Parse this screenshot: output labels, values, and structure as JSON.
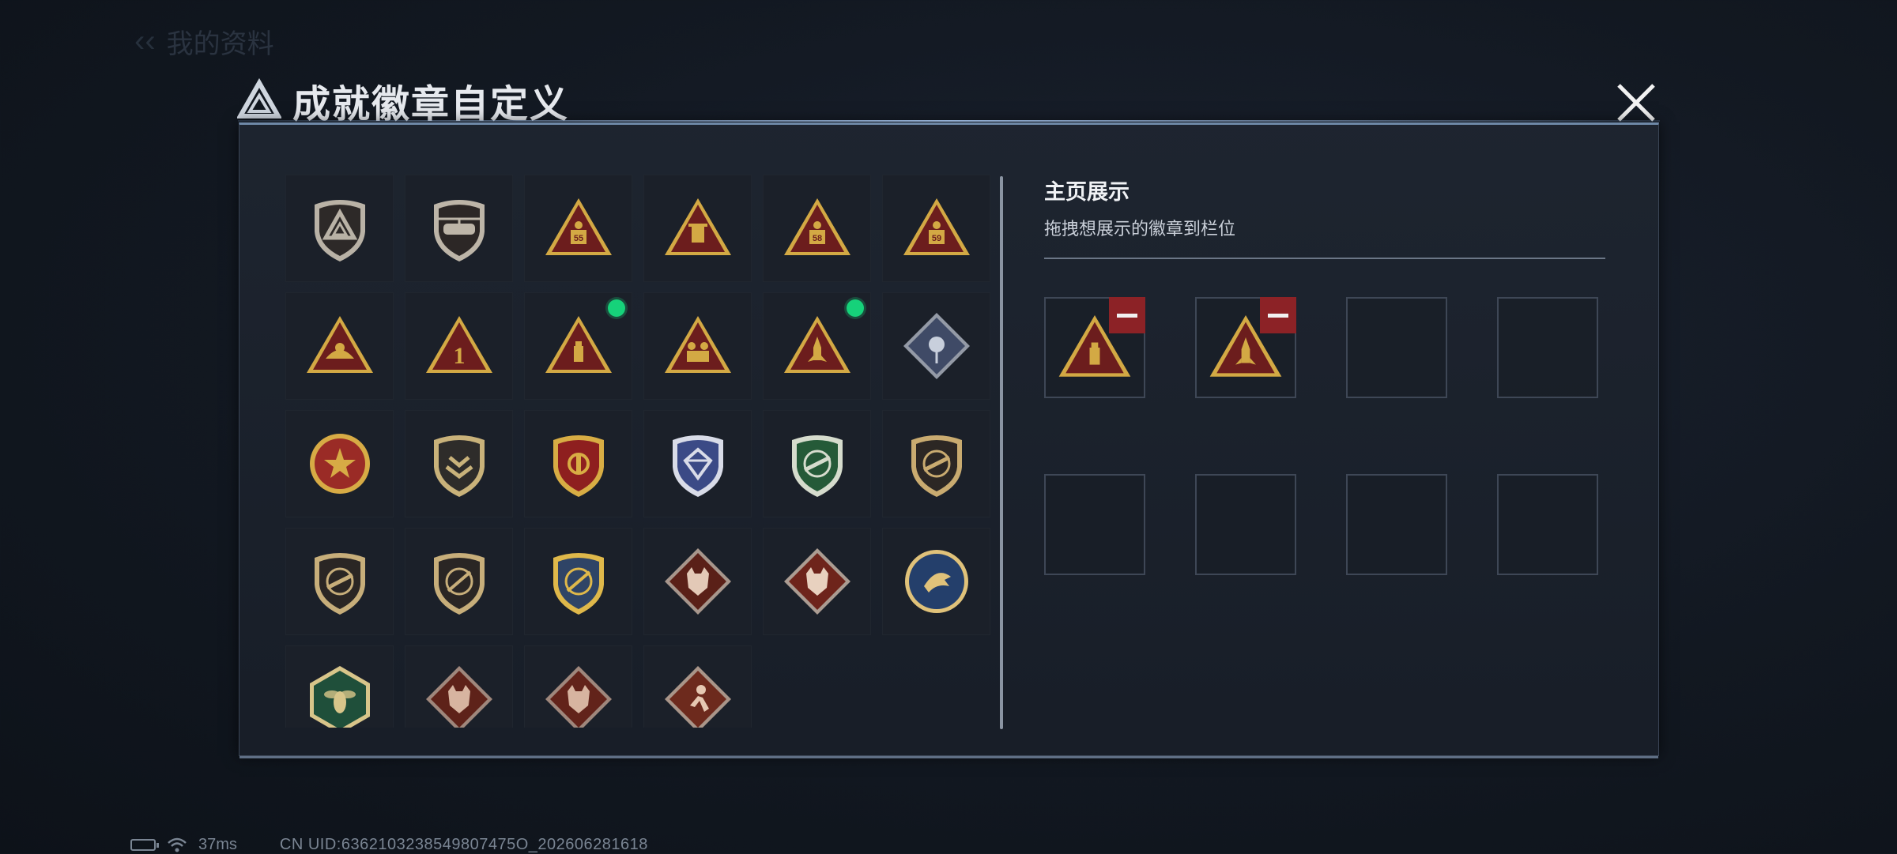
{
  "background": {
    "header_text": "我的资料"
  },
  "dialog": {
    "title": "成就徽章自定义",
    "close_label": "关闭"
  },
  "badges": [
    {
      "name": "shield-delta",
      "kind": "shield",
      "fill": "#2d2928",
      "accent": "#b9b2a6",
      "emblem": "delta"
    },
    {
      "name": "shield-heli",
      "kind": "shield",
      "fill": "#2c2726",
      "accent": "#bdb5a8",
      "emblem": "heli"
    },
    {
      "name": "tri-55",
      "kind": "triangle",
      "fill": "#6c1d1d",
      "accent": "#d3a944",
      "emblem": "55",
      "new": false
    },
    {
      "name": "tri-hourglass",
      "kind": "triangle",
      "fill": "#6c1d1d",
      "accent": "#d3a944",
      "emblem": "lantern"
    },
    {
      "name": "tri-58",
      "kind": "triangle",
      "fill": "#6c1d1d",
      "accent": "#d3a944",
      "emblem": "58"
    },
    {
      "name": "tri-59",
      "kind": "triangle",
      "fill": "#6c1d1d",
      "accent": "#d3a944",
      "emblem": "59"
    },
    {
      "name": "tri-hand",
      "kind": "triangle",
      "fill": "#6c1d1d",
      "accent": "#d3a944",
      "emblem": "hand"
    },
    {
      "name": "tri-one",
      "kind": "triangle",
      "fill": "#6c1d1d",
      "accent": "#d3a944",
      "emblem": "1"
    },
    {
      "name": "tri-usb",
      "kind": "triangle",
      "fill": "#6c1d1d",
      "accent": "#d3a944",
      "emblem": "usb",
      "new": true
    },
    {
      "name": "tri-soldiers",
      "kind": "triangle",
      "fill": "#6c1d1d",
      "accent": "#d3a944",
      "emblem": "soldiers"
    },
    {
      "name": "tri-rocket",
      "kind": "triangle",
      "fill": "#6c1d1d",
      "accent": "#d3a944",
      "emblem": "rocket",
      "new": true
    },
    {
      "name": "diamond-rose",
      "kind": "diamond",
      "fill": "#3f4a66",
      "accent": "#c8cfdc",
      "emblem": "rose"
    },
    {
      "name": "star-red",
      "kind": "star",
      "fill": "#9a2b26",
      "accent": "#d7ab45",
      "emblem": "star"
    },
    {
      "name": "shield-chevron",
      "kind": "shield",
      "fill": "#2e2c2a",
      "accent": "#c9b27a",
      "emblem": "chevron"
    },
    {
      "name": "shield-stars-red",
      "kind": "shield",
      "fill": "#8e1f1f",
      "accent": "#d8ad44",
      "emblem": "wings"
    },
    {
      "name": "shield-diamond",
      "kind": "shield",
      "fill": "#3b4a86",
      "accent": "#d9dce8",
      "emblem": "gem"
    },
    {
      "name": "shield-green-gun",
      "kind": "shield",
      "fill": "#255a38",
      "accent": "#d6dccd",
      "emblem": "gun"
    },
    {
      "name": "shield-brown-gun",
      "kind": "shield",
      "fill": "#2c2724",
      "accent": "#c9ab70",
      "emblem": "gun"
    },
    {
      "name": "shield-dark-gun1",
      "kind": "shield",
      "fill": "#2a2624",
      "accent": "#c7ae7a",
      "emblem": "gun"
    },
    {
      "name": "shield-dark-gun2",
      "kind": "shield",
      "fill": "#2a2624",
      "accent": "#c7ae7a",
      "emblem": "slash"
    },
    {
      "name": "shield-blue-gold",
      "kind": "shield",
      "fill": "#2f4466",
      "accent": "#dfb84a",
      "emblem": "slash"
    },
    {
      "name": "diamond-wolf1",
      "kind": "diamond",
      "fill": "#5a2018",
      "accent": "#e3c9b7",
      "emblem": "beast"
    },
    {
      "name": "diamond-wolf2",
      "kind": "diamond",
      "fill": "#6e241b",
      "accent": "#e8d1bf",
      "emblem": "beast"
    },
    {
      "name": "circle-eagle",
      "kind": "circle",
      "fill": "#243f6b",
      "accent": "#e0c27a",
      "emblem": "eagle"
    },
    {
      "name": "hex-hornet",
      "kind": "hexagon",
      "fill": "#1f4f3a",
      "accent": "#d8c58a",
      "emblem": "hornet"
    },
    {
      "name": "diamond-dragon1",
      "kind": "diamond",
      "fill": "#5e2219",
      "accent": "#d7b4a0",
      "emblem": "beast"
    },
    {
      "name": "diamond-dragon2",
      "kind": "diamond",
      "fill": "#62231a",
      "accent": "#d7b4a0",
      "emblem": "beast"
    },
    {
      "name": "diamond-runner",
      "kind": "diamond",
      "fill": "#6d2a1d",
      "accent": "#e6c8b2",
      "emblem": "runner"
    }
  ],
  "showcase": {
    "title": "主页展示",
    "subtitle": "拖拽想展示的徽章到栏位",
    "slots": [
      {
        "badge": "tri-usb"
      },
      {
        "badge": "tri-rocket"
      },
      {
        "badge": null
      },
      {
        "badge": null
      },
      {
        "badge": null
      },
      {
        "badge": null
      },
      {
        "badge": null
      },
      {
        "badge": null
      }
    ]
  },
  "status_bar": {
    "ping": "37ms",
    "uid": "CN UID:6362103238549807475O_202606281618"
  },
  "colors": {
    "accent_green": "#16d27a",
    "remove_red": "#8c2226",
    "panel_border": "#3b4657"
  }
}
